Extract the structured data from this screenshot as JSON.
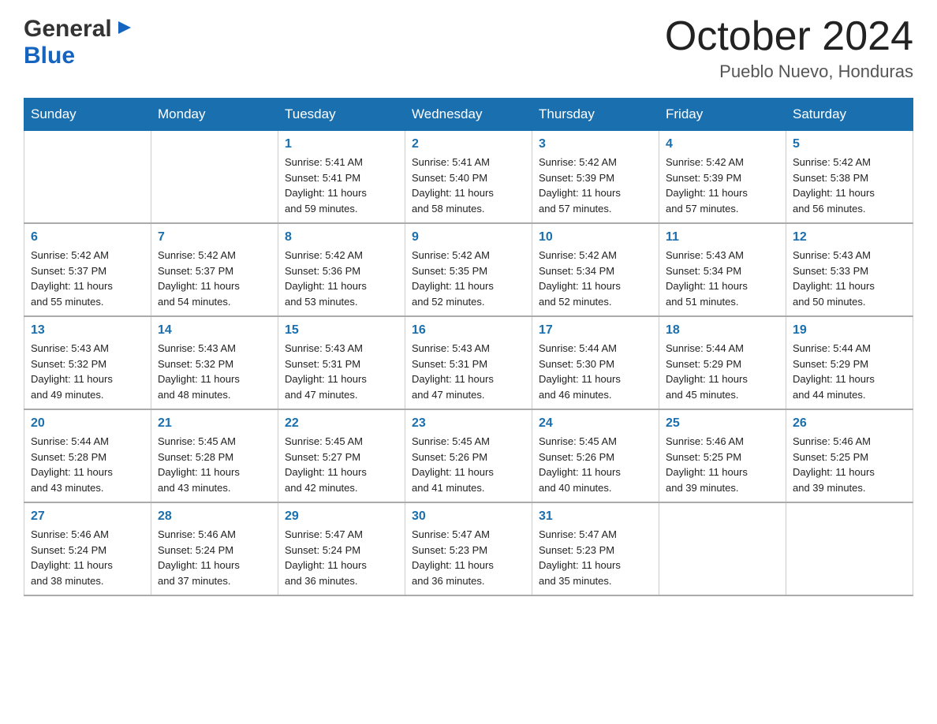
{
  "header": {
    "logo": {
      "general": "General",
      "blue": "Blue",
      "arrow_unicode": "▶"
    },
    "month_title": "October 2024",
    "location": "Pueblo Nuevo, Honduras"
  },
  "calendar": {
    "days_of_week": [
      "Sunday",
      "Monday",
      "Tuesday",
      "Wednesday",
      "Thursday",
      "Friday",
      "Saturday"
    ],
    "weeks": [
      [
        {
          "day": "",
          "info": ""
        },
        {
          "day": "",
          "info": ""
        },
        {
          "day": "1",
          "info": "Sunrise: 5:41 AM\nSunset: 5:41 PM\nDaylight: 11 hours\nand 59 minutes."
        },
        {
          "day": "2",
          "info": "Sunrise: 5:41 AM\nSunset: 5:40 PM\nDaylight: 11 hours\nand 58 minutes."
        },
        {
          "day": "3",
          "info": "Sunrise: 5:42 AM\nSunset: 5:39 PM\nDaylight: 11 hours\nand 57 minutes."
        },
        {
          "day": "4",
          "info": "Sunrise: 5:42 AM\nSunset: 5:39 PM\nDaylight: 11 hours\nand 57 minutes."
        },
        {
          "day": "5",
          "info": "Sunrise: 5:42 AM\nSunset: 5:38 PM\nDaylight: 11 hours\nand 56 minutes."
        }
      ],
      [
        {
          "day": "6",
          "info": "Sunrise: 5:42 AM\nSunset: 5:37 PM\nDaylight: 11 hours\nand 55 minutes."
        },
        {
          "day": "7",
          "info": "Sunrise: 5:42 AM\nSunset: 5:37 PM\nDaylight: 11 hours\nand 54 minutes."
        },
        {
          "day": "8",
          "info": "Sunrise: 5:42 AM\nSunset: 5:36 PM\nDaylight: 11 hours\nand 53 minutes."
        },
        {
          "day": "9",
          "info": "Sunrise: 5:42 AM\nSunset: 5:35 PM\nDaylight: 11 hours\nand 52 minutes."
        },
        {
          "day": "10",
          "info": "Sunrise: 5:42 AM\nSunset: 5:34 PM\nDaylight: 11 hours\nand 52 minutes."
        },
        {
          "day": "11",
          "info": "Sunrise: 5:43 AM\nSunset: 5:34 PM\nDaylight: 11 hours\nand 51 minutes."
        },
        {
          "day": "12",
          "info": "Sunrise: 5:43 AM\nSunset: 5:33 PM\nDaylight: 11 hours\nand 50 minutes."
        }
      ],
      [
        {
          "day": "13",
          "info": "Sunrise: 5:43 AM\nSunset: 5:32 PM\nDaylight: 11 hours\nand 49 minutes."
        },
        {
          "day": "14",
          "info": "Sunrise: 5:43 AM\nSunset: 5:32 PM\nDaylight: 11 hours\nand 48 minutes."
        },
        {
          "day": "15",
          "info": "Sunrise: 5:43 AM\nSunset: 5:31 PM\nDaylight: 11 hours\nand 47 minutes."
        },
        {
          "day": "16",
          "info": "Sunrise: 5:43 AM\nSunset: 5:31 PM\nDaylight: 11 hours\nand 47 minutes."
        },
        {
          "day": "17",
          "info": "Sunrise: 5:44 AM\nSunset: 5:30 PM\nDaylight: 11 hours\nand 46 minutes."
        },
        {
          "day": "18",
          "info": "Sunrise: 5:44 AM\nSunset: 5:29 PM\nDaylight: 11 hours\nand 45 minutes."
        },
        {
          "day": "19",
          "info": "Sunrise: 5:44 AM\nSunset: 5:29 PM\nDaylight: 11 hours\nand 44 minutes."
        }
      ],
      [
        {
          "day": "20",
          "info": "Sunrise: 5:44 AM\nSunset: 5:28 PM\nDaylight: 11 hours\nand 43 minutes."
        },
        {
          "day": "21",
          "info": "Sunrise: 5:45 AM\nSunset: 5:28 PM\nDaylight: 11 hours\nand 43 minutes."
        },
        {
          "day": "22",
          "info": "Sunrise: 5:45 AM\nSunset: 5:27 PM\nDaylight: 11 hours\nand 42 minutes."
        },
        {
          "day": "23",
          "info": "Sunrise: 5:45 AM\nSunset: 5:26 PM\nDaylight: 11 hours\nand 41 minutes."
        },
        {
          "day": "24",
          "info": "Sunrise: 5:45 AM\nSunset: 5:26 PM\nDaylight: 11 hours\nand 40 minutes."
        },
        {
          "day": "25",
          "info": "Sunrise: 5:46 AM\nSunset: 5:25 PM\nDaylight: 11 hours\nand 39 minutes."
        },
        {
          "day": "26",
          "info": "Sunrise: 5:46 AM\nSunset: 5:25 PM\nDaylight: 11 hours\nand 39 minutes."
        }
      ],
      [
        {
          "day": "27",
          "info": "Sunrise: 5:46 AM\nSunset: 5:24 PM\nDaylight: 11 hours\nand 38 minutes."
        },
        {
          "day": "28",
          "info": "Sunrise: 5:46 AM\nSunset: 5:24 PM\nDaylight: 11 hours\nand 37 minutes."
        },
        {
          "day": "29",
          "info": "Sunrise: 5:47 AM\nSunset: 5:24 PM\nDaylight: 11 hours\nand 36 minutes."
        },
        {
          "day": "30",
          "info": "Sunrise: 5:47 AM\nSunset: 5:23 PM\nDaylight: 11 hours\nand 36 minutes."
        },
        {
          "day": "31",
          "info": "Sunrise: 5:47 AM\nSunset: 5:23 PM\nDaylight: 11 hours\nand 35 minutes."
        },
        {
          "day": "",
          "info": ""
        },
        {
          "day": "",
          "info": ""
        }
      ]
    ]
  }
}
